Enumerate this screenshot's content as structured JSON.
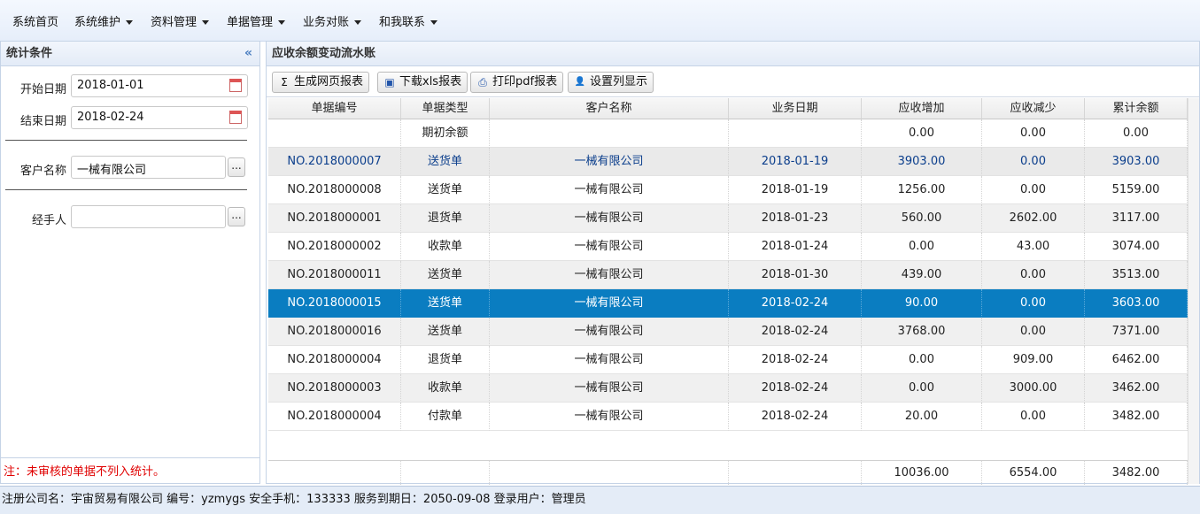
{
  "menu": {
    "items": [
      {
        "label": "系统首页",
        "dropdown": false
      },
      {
        "label": "系统维护",
        "dropdown": true
      },
      {
        "label": "资料管理",
        "dropdown": true
      },
      {
        "label": "单据管理",
        "dropdown": true
      },
      {
        "label": "业务对账",
        "dropdown": true
      },
      {
        "label": "和我联系",
        "dropdown": true
      }
    ]
  },
  "left_panel": {
    "title": "统计条件",
    "collapse_glyph": "«",
    "start_date_label": "开始日期",
    "start_date_value": "2018-01-01",
    "end_date_label": "结束日期",
    "end_date_value": "2018-02-24",
    "customer_label": "客户名称",
    "customer_value": "一械有限公司",
    "handler_label": "经手人",
    "handler_value": "",
    "pick_glyph": "...",
    "note": "注：未审核的单据不列入统计。"
  },
  "right_panel": {
    "title": "应收余额变动流水账",
    "toolbar": [
      {
        "label": "生成网页报表",
        "icon": "sigma-icon",
        "glyph": "Σ"
      },
      {
        "label": "下载xls报表",
        "icon": "save-icon",
        "glyph": "▣"
      },
      {
        "label": "打印pdf报表",
        "icon": "printer-icon",
        "glyph": "⎙"
      },
      {
        "label": "设置列显示",
        "icon": "user-icon",
        "glyph": "👤"
      }
    ],
    "columns": [
      "单据编号",
      "单据类型",
      "客户名称",
      "业务日期",
      "应收增加",
      "应收减少",
      "累计余额"
    ],
    "opening_row": {
      "type": "期初余额",
      "increase": "0.00",
      "decrease": "0.00",
      "balance": "0.00"
    },
    "rows": [
      {
        "no": "NO.2018000007",
        "type": "送货单",
        "customer": "一械有限公司",
        "date": "2018-01-19",
        "increase": "3903.00",
        "decrease": "0.00",
        "balance": "3903.00"
      },
      {
        "no": "NO.2018000008",
        "type": "送货单",
        "customer": "一械有限公司",
        "date": "2018-01-19",
        "increase": "1256.00",
        "decrease": "0.00",
        "balance": "5159.00"
      },
      {
        "no": "NO.2018000001",
        "type": "退货单",
        "customer": "一械有限公司",
        "date": "2018-01-23",
        "increase": "560.00",
        "decrease": "2602.00",
        "balance": "3117.00"
      },
      {
        "no": "NO.2018000002",
        "type": "收款单",
        "customer": "一械有限公司",
        "date": "2018-01-24",
        "increase": "0.00",
        "decrease": "43.00",
        "balance": "3074.00"
      },
      {
        "no": "NO.2018000011",
        "type": "送货单",
        "customer": "一械有限公司",
        "date": "2018-01-30",
        "increase": "439.00",
        "decrease": "0.00",
        "balance": "3513.00"
      },
      {
        "no": "NO.2018000015",
        "type": "送货单",
        "customer": "一械有限公司",
        "date": "2018-02-24",
        "increase": "90.00",
        "decrease": "0.00",
        "balance": "3603.00"
      },
      {
        "no": "NO.2018000016",
        "type": "送货单",
        "customer": "一械有限公司",
        "date": "2018-02-24",
        "increase": "3768.00",
        "decrease": "0.00",
        "balance": "7371.00"
      },
      {
        "no": "NO.2018000004",
        "type": "退货单",
        "customer": "一械有限公司",
        "date": "2018-02-24",
        "increase": "0.00",
        "decrease": "909.00",
        "balance": "6462.00"
      },
      {
        "no": "NO.2018000003",
        "type": "收款单",
        "customer": "一械有限公司",
        "date": "2018-02-24",
        "increase": "0.00",
        "decrease": "3000.00",
        "balance": "3462.00"
      },
      {
        "no": "NO.2018000004",
        "type": "付款单",
        "customer": "一械有限公司",
        "date": "2018-02-24",
        "increase": "20.00",
        "decrease": "0.00",
        "balance": "3482.00"
      }
    ],
    "totals": {
      "increase": "10036.00",
      "decrease": "6554.00",
      "balance": "3482.00"
    },
    "hover_row_index": 0,
    "selected_row_index": 5
  },
  "status_bar": "注册公司名：宇宙贸易有限公司 编号：yzmygs 安全手机：133333 服务到期日：2050-09-08 登录用户：管理员",
  "colors": {
    "selection": "#0a7dc1",
    "note": "#e00000",
    "accent": "#4a7ec0"
  }
}
